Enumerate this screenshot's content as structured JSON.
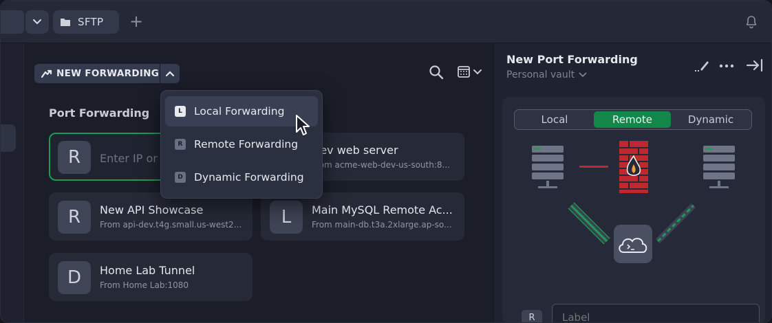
{
  "tabs": {
    "sftp_label": "SFTP",
    "add_symbol": "+"
  },
  "toolbar": {
    "new_forwarding_label": "NEW FORWARDING"
  },
  "section": {
    "title": "Port Forwarding"
  },
  "editing_card": {
    "avatar": "R",
    "placeholder": "Enter IP or H"
  },
  "cards": [
    {
      "avatar": "",
      "title": "Dev web server",
      "subtitle": "From acme-web-dev-us-south:8..."
    },
    {
      "avatar": "R",
      "title": "New API Showcase",
      "subtitle": "From api-dev.t4g.small.us-west2..."
    },
    {
      "avatar": "L",
      "title": "Main MySQL Remote Ac...",
      "subtitle": "From main-db.t3a.2xlarge.ap-so..."
    },
    {
      "avatar": "D",
      "title": "Home Lab Tunnel",
      "subtitle": "From Home Lab:1080"
    }
  ],
  "dropdown": {
    "items": [
      {
        "badge": "L",
        "label": "Local Forwarding"
      },
      {
        "badge": "R",
        "label": "Remote Forwarding"
      },
      {
        "badge": "D",
        "label": "Dynamic Forwarding"
      }
    ]
  },
  "panel": {
    "title": "New Port Forwarding",
    "vault": "Personal vault",
    "segments": [
      "Local",
      "Remote",
      "Dynamic"
    ],
    "active_segment": "Remote",
    "label_badge": "R",
    "label_placeholder": "Label"
  },
  "colors": {
    "accent_green": "#13874a",
    "firewall_red": "#c0282f"
  }
}
